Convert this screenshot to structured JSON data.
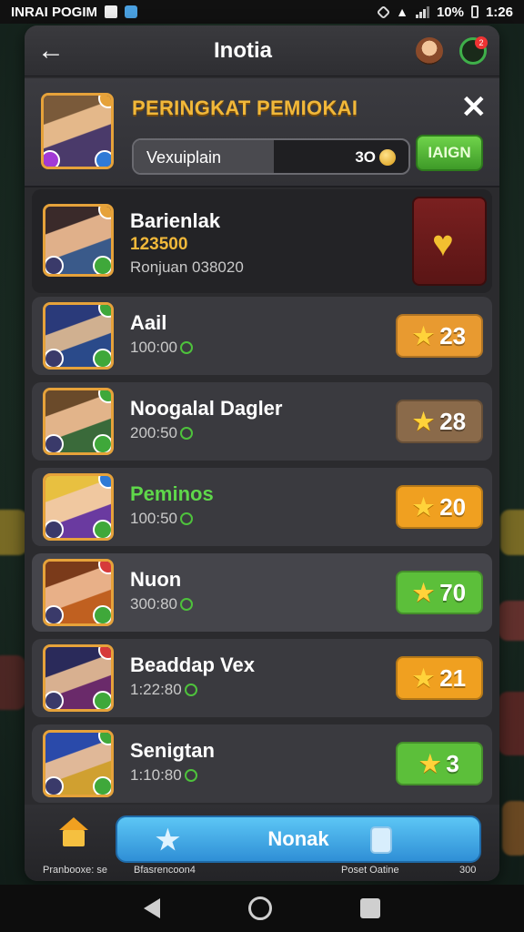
{
  "status_bar": {
    "carrier": "INRAI POGIM",
    "battery": "10%",
    "time": "1:26",
    "icons": [
      "image-icon",
      "shield-app-icon",
      "nfc-icon",
      "wifi-icon",
      "signal-icon"
    ]
  },
  "topbar": {
    "back_icon": "arrow-left-icon",
    "title": "Inotia",
    "icons": [
      "character-icon",
      "chat-icon"
    ],
    "chat_badge": "2"
  },
  "header": {
    "title": "PERINGKAT PEMIOKAI",
    "close_icon": "close-icon",
    "search_placeholder": "Vexuiplain",
    "search_value": "3O",
    "search_fill": 0.51,
    "go_label": "IAIGN"
  },
  "rows": [
    {
      "name": "Barienlak",
      "score_line": "123500",
      "sub": "Ronjuan 038020",
      "reward_icon": "heart-icon",
      "badge_color": "#e6a23a",
      "name_color": "#ffffff"
    },
    {
      "name": "Aail",
      "sub": "100:00",
      "score": "23",
      "btn_color": "#e89a30",
      "badge_color": "#3fa83a",
      "name_color": "#ffffff"
    },
    {
      "name": "Noogalal Dagler",
      "sub": "200:50",
      "score": "28",
      "btn_color": "#8a6a4a",
      "badge_color": "#3fa83a",
      "name_color": "#ffffff"
    },
    {
      "name": "Peminos",
      "sub": "100:50",
      "score": "20",
      "btn_color": "#f0a020",
      "badge_color": "#2f7ad6",
      "name_color": "#5fd84a"
    },
    {
      "name": "Nuon",
      "sub": "300:80",
      "score": "70",
      "btn_color": "#5cbf3a",
      "badge_color": "#d63a3a",
      "name_color": "#ffffff"
    },
    {
      "name": "Beaddap Vex",
      "sub": "1:22:80",
      "score": "21",
      "btn_color": "#f0a020",
      "badge_color": "#d63a3a",
      "name_color": "#ffffff"
    },
    {
      "name": "Senigtan",
      "sub": "1:10:80",
      "score": "3",
      "btn_color": "#5cbf3a",
      "badge_color": "#3fa83a",
      "name_color": "#ffffff"
    }
  ],
  "bottom_bar": {
    "main_label": "Nonak",
    "home_icon": "home-icon",
    "star_icon": "star-icon",
    "card_icon": "card-icon",
    "labels": [
      "Pranbooxe: se",
      "Bfasrencoon4",
      "Poset Oatine",
      "300"
    ]
  },
  "nav": {
    "icons": [
      "nav-back-icon",
      "nav-home-icon",
      "nav-recent-icon"
    ]
  }
}
